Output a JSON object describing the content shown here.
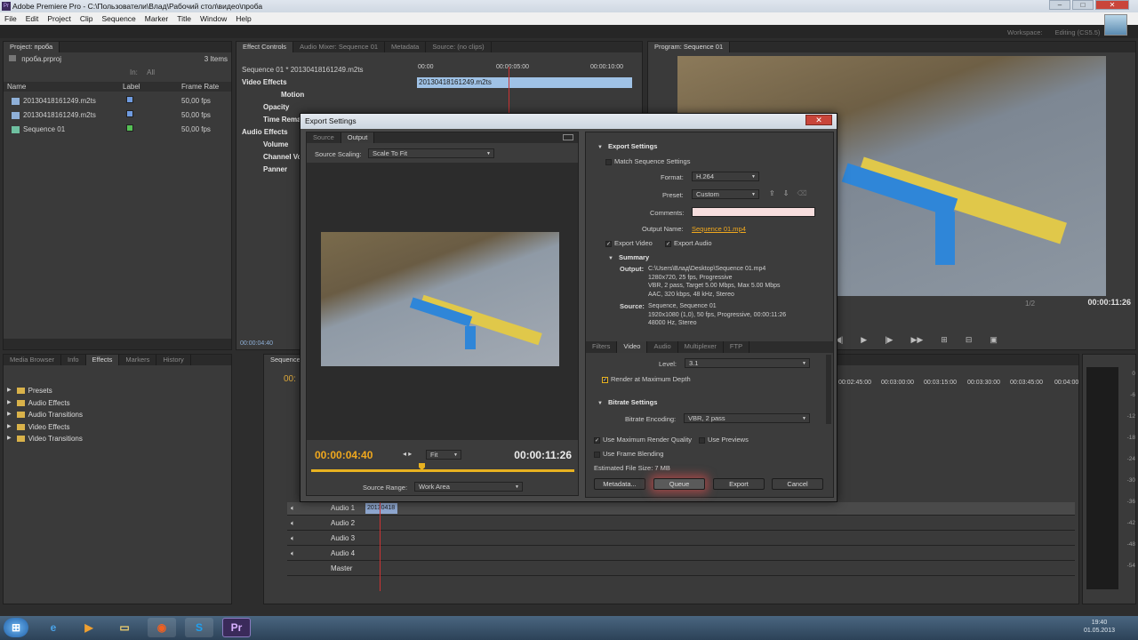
{
  "app": {
    "title": "Adobe Premiere Pro - C:\\Пользователи\\Влад\\Рабочий стол\\видео\\проба"
  },
  "menu": [
    "File",
    "Edit",
    "Project",
    "Clip",
    "Sequence",
    "Marker",
    "Title",
    "Window",
    "Help"
  ],
  "workspace": {
    "label": "Workspace:",
    "value": "Editing (CS5.5)"
  },
  "project": {
    "tab": "Project: проба",
    "file": "проба.prproj",
    "count": "3 Items",
    "in_label": "In:",
    "in_value": "All",
    "columns": [
      "Name",
      "Label",
      "Frame Rate"
    ],
    "items": [
      {
        "name": "20130418161249.m2ts",
        "color": "#6f9be0",
        "rate": "50,00 fps"
      },
      {
        "name": "20130418161249.m2ts",
        "color": "#6f9be0",
        "rate": "50,00 fps"
      },
      {
        "name": "Sequence 01",
        "color": "#55c055",
        "rate": "50,00 fps"
      }
    ]
  },
  "effect_controls": {
    "tabs": [
      "Effect Controls",
      "Audio Mixer: Sequence 01",
      "Metadata",
      "Source: (no clips)"
    ],
    "sequence": "Sequence 01 * 20130418161249.m2ts",
    "clip": "20130418161249.m2ts",
    "ruler": [
      "00:00",
      "00:00:05:00",
      "00:00:10:00"
    ],
    "video_effects": "Video Effects",
    "motion": "Motion",
    "opacity": "Opacity",
    "time_remap": "Time Rema",
    "audio_effects": "Audio Effects",
    "volume": "Volume",
    "channel_volume": "Channel Vo",
    "panner": "Panner",
    "time": "00:00:04:40"
  },
  "program": {
    "tab": "Program: Sequence 01",
    "time": "00:00:11:26",
    "zoom": "1/2"
  },
  "effects": {
    "tabs": [
      "Media Browser",
      "Info",
      "Effects",
      "Markers",
      "History"
    ],
    "folders": [
      "Presets",
      "Audio Effects",
      "Audio Transitions",
      "Video Effects",
      "Video Transitions"
    ]
  },
  "timeline": {
    "tab": "Sequence 01",
    "time": "00:",
    "ruler": [
      "00:02:45:00",
      "00:03:00:00",
      "00:03:15:00",
      "00:03:30:00",
      "00:03:45:00",
      "00:04:00"
    ],
    "tracks": [
      "Audio 1",
      "Audio 2",
      "Audio 3",
      "Audio 4",
      "Master"
    ],
    "clip": "20130418",
    "meter": [
      "0",
      "-6",
      "-12",
      "-18",
      "-24",
      "-30",
      "-36",
      "-42",
      "-48",
      "-54"
    ]
  },
  "dialog": {
    "title": "Export Settings",
    "tabs": [
      "Source",
      "Output"
    ],
    "source_scaling_label": "Source Scaling:",
    "source_scaling": "Scale To Fit",
    "current_time": "00:00:04:40",
    "duration": "00:00:11:26",
    "fit": "Fit",
    "source_range_label": "Source Range:",
    "source_range": "Work Area",
    "export_settings": "Export Settings",
    "match_sequence": "Match Sequence Settings",
    "format_label": "Format:",
    "format": "H.264",
    "preset_label": "Preset:",
    "preset": "Custom",
    "comments_label": "Comments:",
    "output_name_label": "Output Name:",
    "output_name": "Sequence 01.mp4",
    "export_video": "Export Video",
    "export_audio": "Export Audio",
    "summary": "Summary",
    "output_label": "Output:",
    "output_lines": [
      "C:\\Users\\Влад\\Desktop\\Sequence 01.mp4",
      "1280x720, 25 fps, Progressive",
      "VBR, 2 pass, Target 5.00 Mbps, Max 5.00 Mbps",
      "AAC, 320 kbps, 48 kHz, Stereo"
    ],
    "source_label": "Source:",
    "source_lines": [
      "Sequence, Sequence 01",
      "1920x1080 (1,0), 50 fps, Progressive, 00:00:11:26",
      "48000 Hz, Stereo"
    ],
    "settings_tabs": [
      "Filters",
      "Video",
      "Audio",
      "Multiplexer",
      "FTP"
    ],
    "level_label": "Level:",
    "level": "3.1",
    "render_max_depth": "Render at Maximum Depth",
    "bitrate_settings": "Bitrate Settings",
    "bitrate_encoding_label": "Bitrate Encoding:",
    "bitrate_encoding": "VBR, 2 pass",
    "use_max_quality": "Use Maximum Render Quality",
    "use_previews": "Use Previews",
    "use_frame_blending": "Use Frame Blending",
    "estimated_size": "Estimated File Size: 7 MB",
    "buttons": {
      "metadata": "Metadata...",
      "queue": "Queue",
      "export": "Export",
      "cancel": "Cancel"
    }
  },
  "taskbar": {
    "time": "19:40",
    "date": "01.05.2013"
  }
}
